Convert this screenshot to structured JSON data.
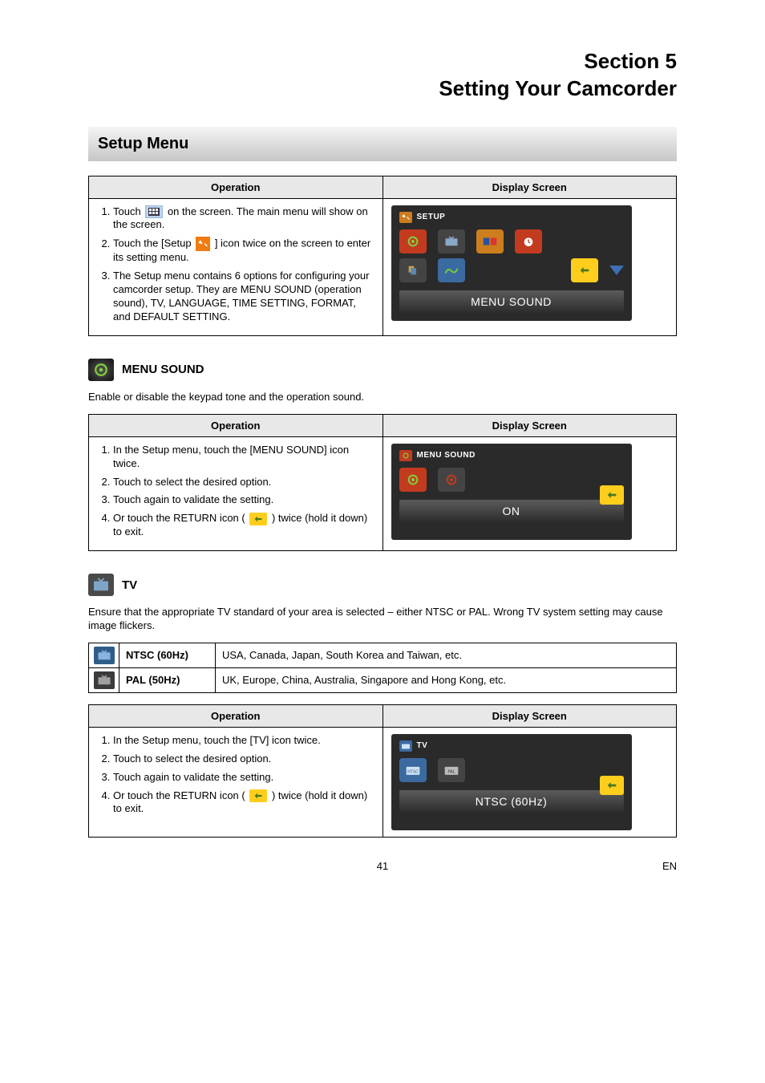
{
  "page": {
    "section_line1": "Section 5",
    "section_line2": "Setting Your Camcorder",
    "footer_page": "41",
    "footer_lang": "EN"
  },
  "setup_menu": {
    "title": "Setup Menu",
    "col_op": "Operation",
    "col_disp": "Display Screen",
    "steps": {
      "s1a": "Touch ",
      "s1b": " on the screen. The main menu will show on the screen.",
      "s2a": "Touch the [Setup ",
      "s2b": " ] icon twice on the screen to enter its setting menu.",
      "s3": "The Setup menu contains 6 options for configuring your camcorder setup. They are MENU SOUND (operation sound), TV, LANGUAGE, TIME SETTING, FORMAT, and DEFAULT SETTING."
    },
    "screen": {
      "title": "SETUP",
      "label": "MENU SOUND"
    }
  },
  "menu_sound": {
    "header": "MENU SOUND",
    "desc": "Enable or disable the keypad tone and the operation sound.",
    "col_op": "Operation",
    "col_disp": "Display Screen",
    "steps": {
      "s1": "In the Setup menu, touch the [MENU SOUND] icon twice.",
      "s2": "Touch to select the desired option.",
      "s3": "Touch again to validate the setting.",
      "s4a": "Or touch the RETURN icon ( ",
      "s4b": " ) twice (hold it down) to exit."
    },
    "screen": {
      "title": "MENU SOUND",
      "label": "ON"
    }
  },
  "tv": {
    "header": "TV",
    "desc": "Ensure that the appropriate TV standard of your area is selected – either NTSC or PAL. Wrong TV system setting may cause image flickers.",
    "standards": {
      "ntsc_label": "NTSC (60Hz)",
      "ntsc_regions": "USA, Canada, Japan, South Korea and Taiwan, etc.",
      "pal_label": "PAL (50Hz)",
      "pal_regions": "UK, Europe, China, Australia, Singapore and Hong Kong, etc."
    },
    "col_op": "Operation",
    "col_disp": "Display Screen",
    "steps": {
      "s1": "In the Setup menu, touch the [TV] icon twice.",
      "s2": "Touch to select the desired option.",
      "s3": "Touch again to validate the setting.",
      "s4a": "Or touch the RETURN icon ( ",
      "s4b": " ) twice (hold it down) to exit."
    },
    "screen": {
      "title": "TV",
      "label": "NTSC (60Hz)"
    }
  }
}
